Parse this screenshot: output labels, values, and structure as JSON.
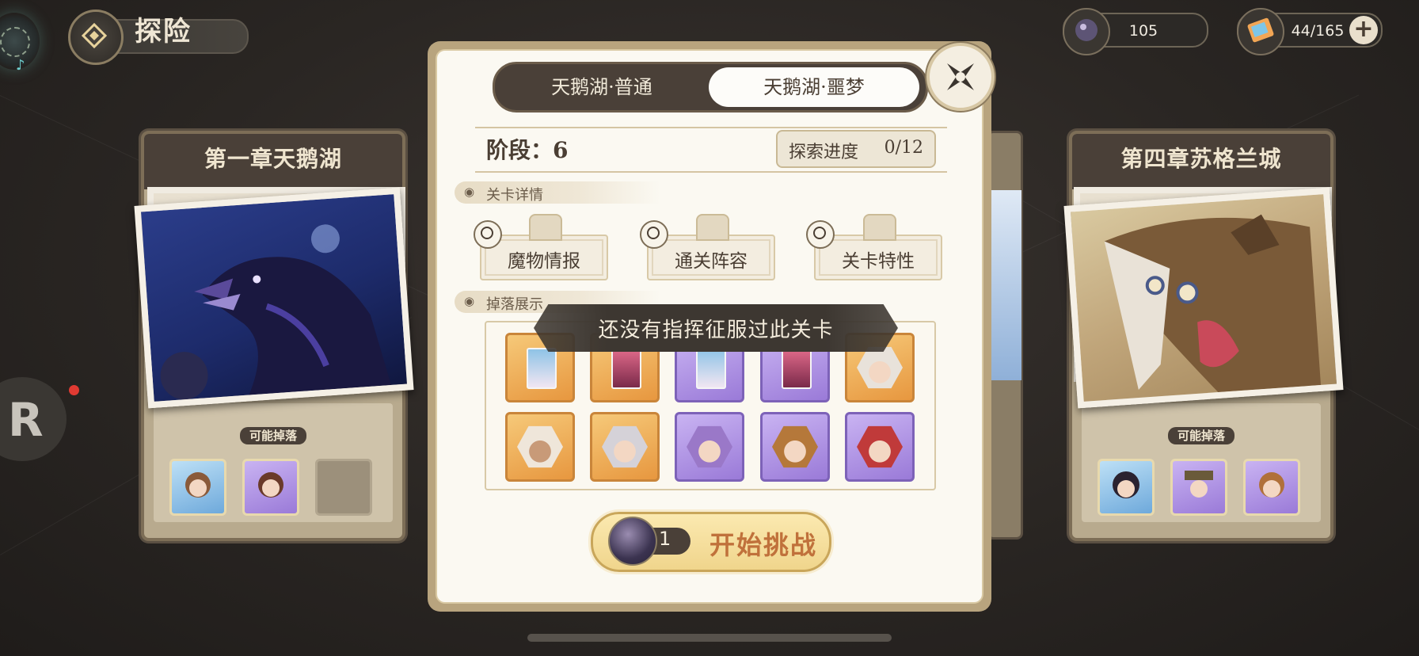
{
  "header": {
    "title": "探险",
    "back_icon": "diamond-emblem-icon"
  },
  "currencies": [
    {
      "name": "stamina-orb",
      "value": "105"
    },
    {
      "name": "ticket",
      "value": "44/165"
    }
  ],
  "plus_label": "+",
  "left_card": {
    "title": "第一章天鹅湖",
    "drop_label": "可能掉落"
  },
  "right_card": {
    "title": "第四章苏格兰城",
    "drop_label": "可能掉落"
  },
  "r_badge": {
    "letter": "R"
  },
  "panel": {
    "tabs": [
      {
        "label": "天鹅湖·普通",
        "active": false
      },
      {
        "label": "天鹅湖·噩梦",
        "active": true
      }
    ],
    "stage": "阶段：6",
    "progress_label": "探索进度",
    "progress_value": "0/12",
    "details_title": "关卡详情",
    "detail_buttons": [
      "魔物情报",
      "通关阵容",
      "关卡特性"
    ],
    "drops_title": "掉落展示",
    "toast": "还没有指挥征服过此关卡",
    "start": {
      "cost": "1",
      "label": "开始挑战"
    }
  },
  "colors": {
    "gold_item": "#e7973f",
    "purple_item": "#9a7ad8",
    "panel_border": "#b8a47e",
    "start_text": "#c0713b"
  }
}
